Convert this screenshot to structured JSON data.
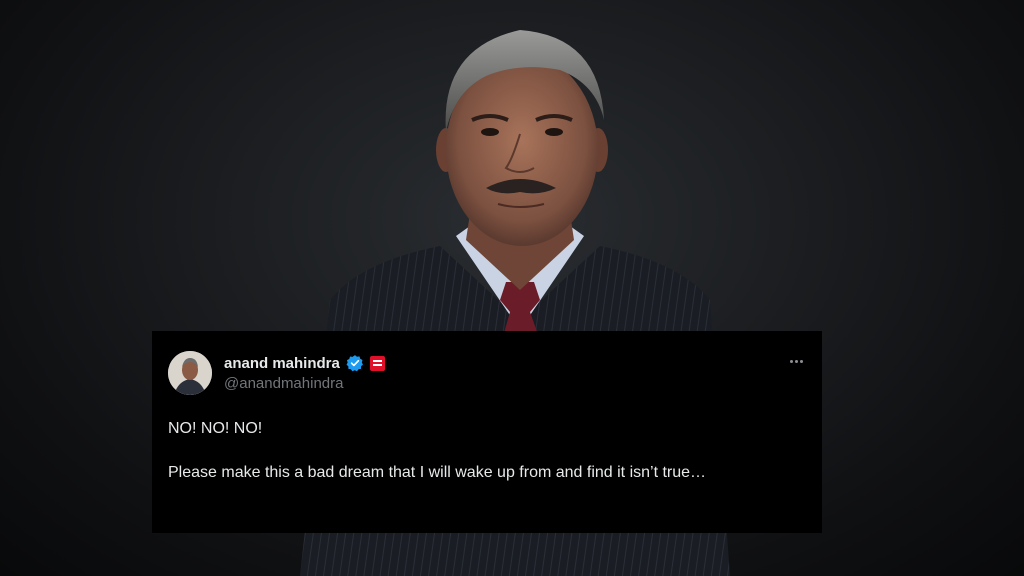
{
  "tweet": {
    "display_name": "anand mahindra",
    "handle": "@anandmahindra",
    "verified": true,
    "text_line_1": "NO! NO! NO!",
    "text_line_2": "Please make this a bad dream that I will wake up from and find it isn’t true…"
  },
  "colors": {
    "card_background": "#000000",
    "name_text": "#e7e9ea",
    "handle_text": "#71767b",
    "verified_badge": "#1d9bf0",
    "affiliate_badge": "#e0102a"
  },
  "icons": [
    "verified-badge-icon",
    "affiliate-badge-icon",
    "more-options-icon"
  ]
}
